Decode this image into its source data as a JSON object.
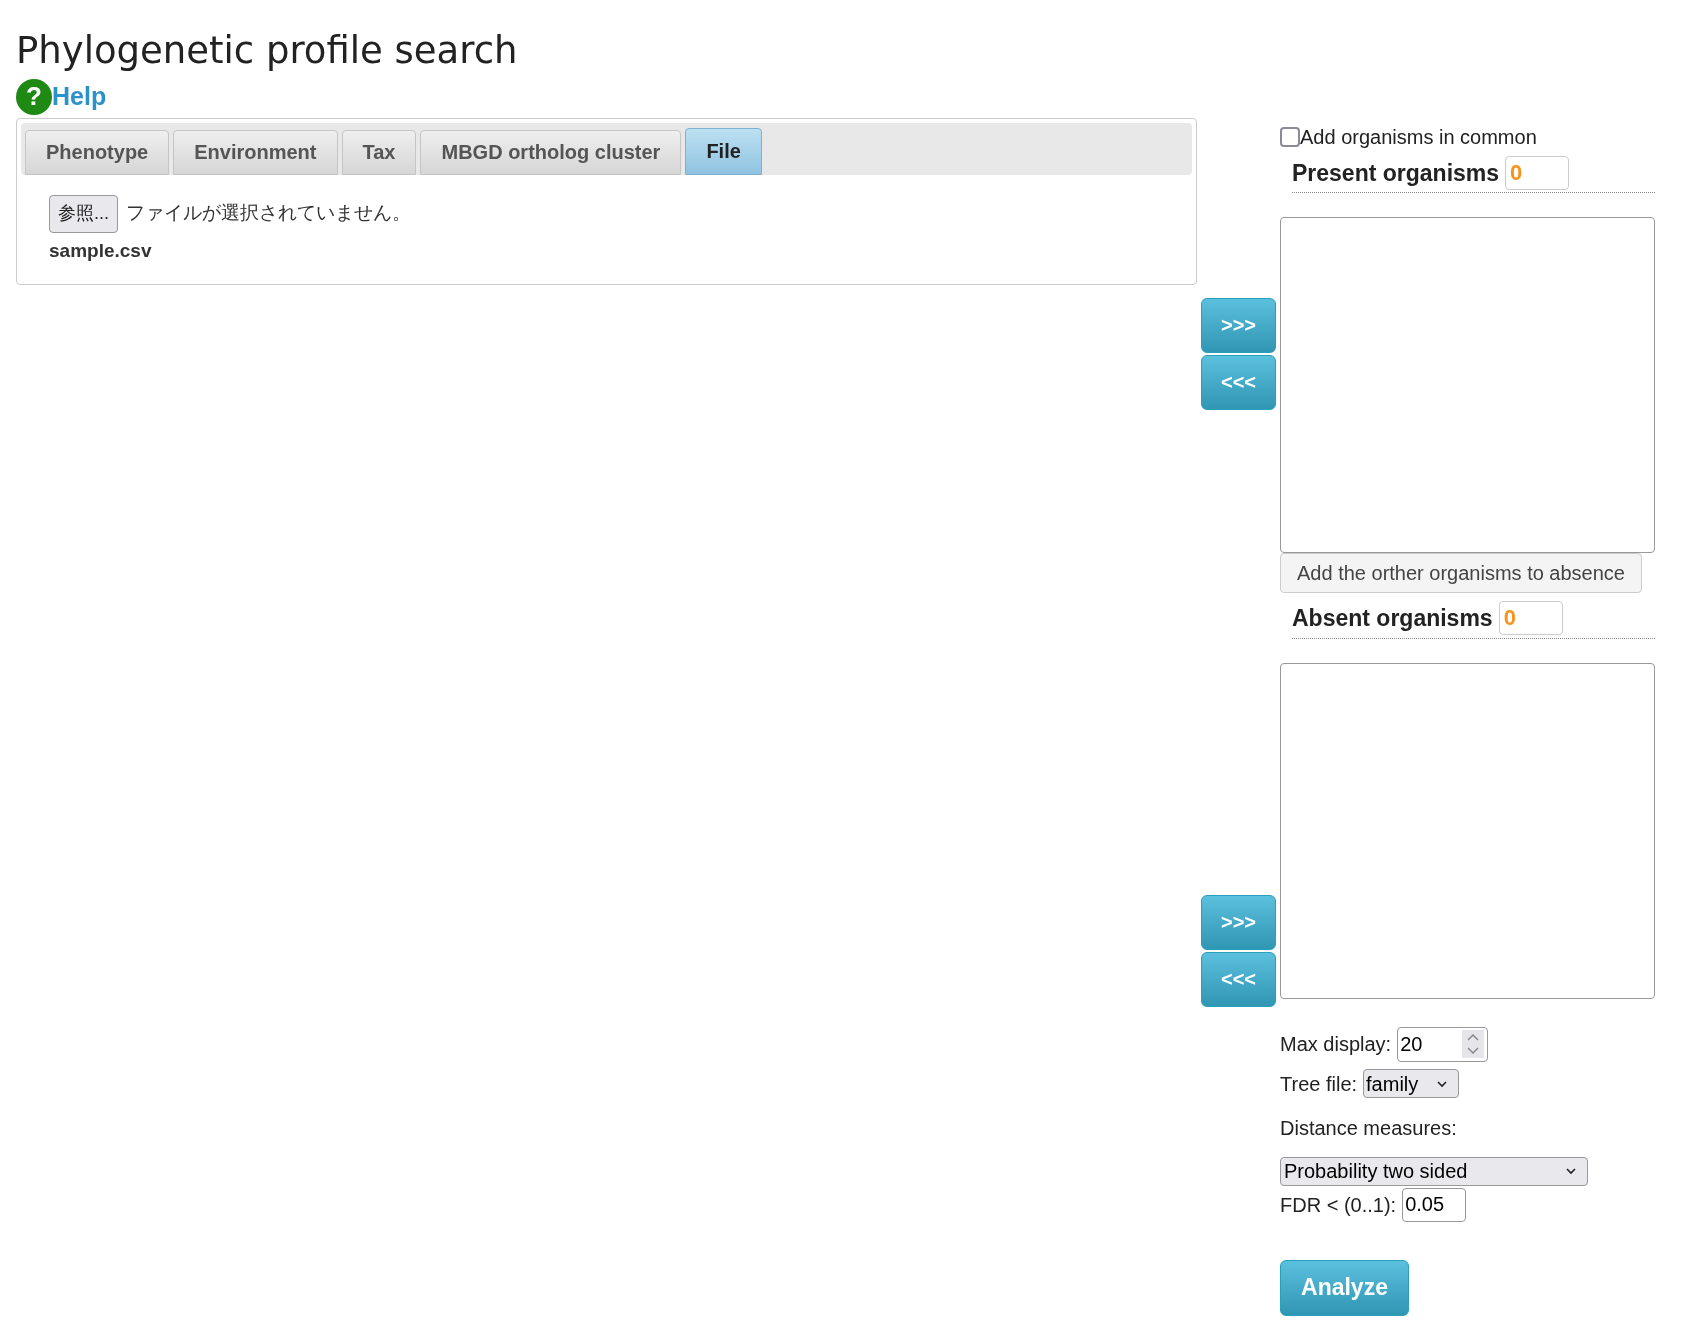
{
  "title": "Phylogenetic profile search",
  "help": {
    "icon_text": "?",
    "label": "Help"
  },
  "tabs": [
    {
      "label": "Phenotype",
      "selected": false
    },
    {
      "label": "Environment",
      "selected": false
    },
    {
      "label": "Tax",
      "selected": false
    },
    {
      "label": "MBGD ortholog cluster",
      "selected": false
    },
    {
      "label": "File",
      "selected": true
    }
  ],
  "file_input": {
    "button": "参照...",
    "status": "ファイルが選択されていません。",
    "filename": "sample.csv"
  },
  "add_in_common": {
    "label": "Add organisms in common",
    "checked": false
  },
  "present": {
    "label": "Present organisms",
    "count": "0",
    "move_buttons": [
      ">>>",
      "<<<"
    ]
  },
  "add_other_button": "Add the orther organisms to absence",
  "absent": {
    "label": "Absent organisms",
    "count": "0",
    "move_buttons": [
      ">>>",
      "<<<"
    ]
  },
  "max_display": {
    "label": "Max display:",
    "value": "20"
  },
  "tree_file": {
    "label": "Tree file:",
    "value": "family"
  },
  "distance": {
    "label": "Distance measures:",
    "value": "Probability two sided"
  },
  "fdr": {
    "label": "FDR < (0..1):",
    "value": "0.05"
  },
  "analyze_button": "Analyze"
}
